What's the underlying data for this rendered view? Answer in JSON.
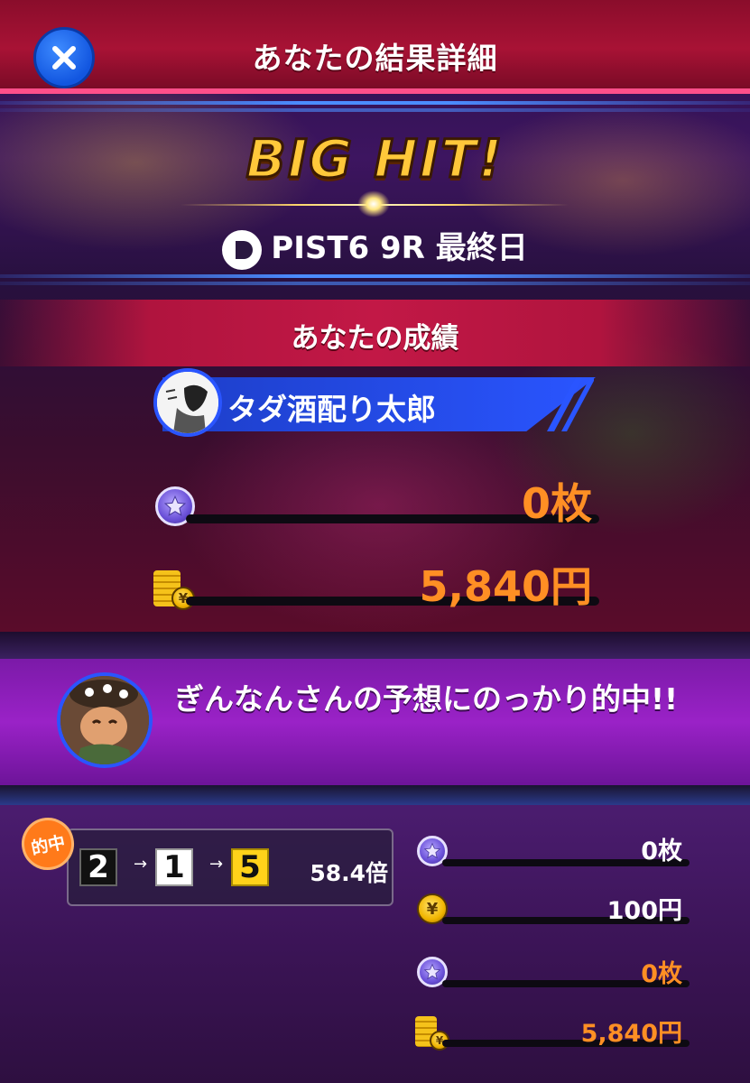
{
  "header": {
    "title": "あなたの結果詳細",
    "close_icon": "close-icon"
  },
  "result": {
    "badge": "BIG HIT!",
    "race_label": "PIST6 9R 最終日"
  },
  "section_title": "あなたの成績",
  "user": {
    "name": "タダ酒配り太郎"
  },
  "totals": {
    "points_value": "0枚",
    "payout_value": "5,840円"
  },
  "tipster": {
    "message": "ぎんなんさんの予想にのっかり的中!!"
  },
  "bet": {
    "hit_label": "的中",
    "order": [
      "2",
      "1",
      "5"
    ],
    "odds": "58.4倍"
  },
  "bet_details": {
    "stake_points": "0枚",
    "stake_yen": "100円",
    "return_points": "0枚",
    "return_yen": "5,840円"
  },
  "colors": {
    "accent_orange": "#ff8f24",
    "header_red": "#a81235",
    "user_blue": "#2a55ff"
  }
}
